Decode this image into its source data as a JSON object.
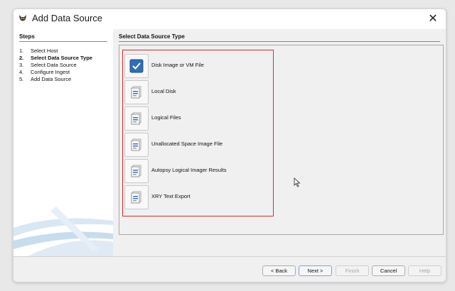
{
  "window": {
    "title": "Add Data Source",
    "close_icon": "close-icon"
  },
  "steps": {
    "heading": "Steps",
    "items": [
      {
        "num": "1.",
        "label": "Select Host",
        "active": false
      },
      {
        "num": "2.",
        "label": "Select Data Source Type",
        "active": true
      },
      {
        "num": "3.",
        "label": "Select Data Source",
        "active": false
      },
      {
        "num": "4.",
        "label": "Configure Ingest",
        "active": false
      },
      {
        "num": "5.",
        "label": "Add Data Source",
        "active": false
      }
    ]
  },
  "main": {
    "heading": "Select Data Source Type",
    "options": [
      {
        "label": "Disk Image or VM File",
        "selected": true,
        "icon": "checkbox-checked-icon"
      },
      {
        "label": "Local Disk",
        "selected": false,
        "icon": "document-stack-icon"
      },
      {
        "label": "Logical Files",
        "selected": false,
        "icon": "document-stack-icon"
      },
      {
        "label": "Unallocated Space Image File",
        "selected": false,
        "icon": "document-stack-icon"
      },
      {
        "label": "Autopsy Logical Imager Results",
        "selected": false,
        "icon": "document-stack-icon"
      },
      {
        "label": "XRY Text Export",
        "selected": false,
        "icon": "document-stack-icon"
      }
    ]
  },
  "buttons": {
    "back": "< Back",
    "next": "Next >",
    "finish": "Finish",
    "cancel": "Cancel",
    "help": "Help"
  },
  "colors": {
    "highlight_border": "#e0272f",
    "selected_icon": "#2f6fb6",
    "primary_border": "#7aa6d6"
  }
}
